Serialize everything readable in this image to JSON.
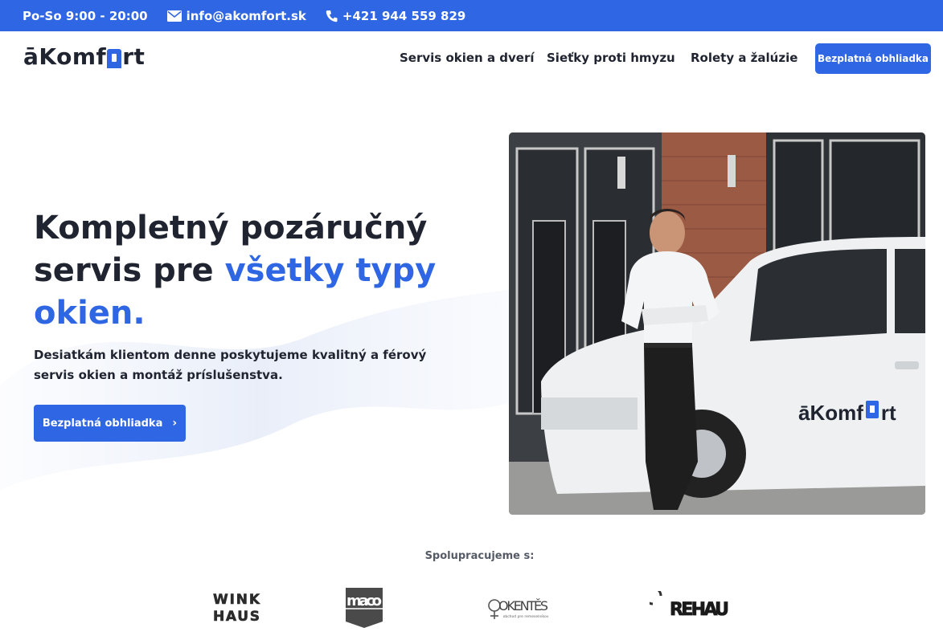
{
  "topbar": {
    "hours": "Po-So 9:00 - 20:00",
    "email": "info@akomfort.sk",
    "phone": "+421 944 559 829"
  },
  "header": {
    "logo": {
      "part1": "āKomf",
      "part2": "rt"
    },
    "nav": [
      "Servis okien a dverí",
      "Sieťky proti hmyzu",
      "Rolety a žalúzie"
    ],
    "cta": "Bezplatná obhliadka"
  },
  "hero": {
    "title_line1": "Kompletný pozáručný",
    "title_line2_plain": "servis pre ",
    "title_line2_accent": "všetky typy",
    "title_line3_accent": "okien.",
    "description": "Desiatkám klientom denne poskytujeme kvalitný a férový servis okien a montáž príslušenstva.",
    "button": "Bezplatná obhliadka",
    "button_chevron": "›",
    "van_logo": {
      "part1": "āKomf",
      "part2": "rt"
    }
  },
  "partners": {
    "label": "Spolupracujeme s:",
    "logos": {
      "winkhaus": {
        "line1": "WINK",
        "line2": "HAUS"
      },
      "maco": "maco",
      "okentes": {
        "name": "OKENTĚS",
        "tagline": "obchod pre remeselníkov"
      },
      "rehau": "REHAU"
    }
  },
  "colors": {
    "brand": "#2f66e3",
    "text": "#1f2430"
  }
}
